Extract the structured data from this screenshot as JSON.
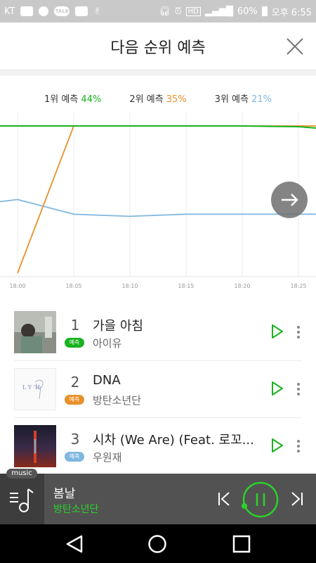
{
  "status_bar": {
    "carrier": "KT",
    "battery": "60%",
    "time": "오후 6:55",
    "talk": "TALK",
    "hd": "HD"
  },
  "header": {
    "title": "다음 순위 예측"
  },
  "legend": [
    {
      "label": "1위 예측",
      "value": "44%",
      "color": "#19b31f"
    },
    {
      "label": "2위 예측",
      "value": "35%",
      "color": "#e8902b"
    },
    {
      "label": "3위 예측",
      "value": "21%",
      "color": "#7fb7e0"
    }
  ],
  "chart_data": {
    "type": "line",
    "x": [
      "18:00",
      "18:05",
      "18:10",
      "18:15",
      "18:20",
      "18:25"
    ],
    "series": [
      {
        "values": [
          1,
          1,
          1,
          1,
          1,
          1.01
        ],
        "color": "#19b31f"
      },
      {
        "values": [
          3.1,
          1,
          1,
          1,
          1,
          1
        ],
        "color": "#e8902b"
      },
      {
        "values": [
          2.05,
          2.26,
          2.29,
          2.26,
          2.26,
          2.26
        ],
        "color": "#7fb7e0"
      }
    ],
    "ylim": [
      0.98,
      3.15
    ],
    "grid": true
  },
  "songs": [
    {
      "rank": "1",
      "title": "가을 아침",
      "artist": "아이유",
      "badge": "예측",
      "badge_color": "#19b31f"
    },
    {
      "rank": "2",
      "title": "DNA",
      "artist": "방탄소년단",
      "badge": "예측",
      "badge_color": "#e8902b"
    },
    {
      "rank": "3",
      "title": "시차 (We Are) (Feat. 로꼬...",
      "artist": "우원재",
      "badge": "예측",
      "badge_color": "#7fb7e0"
    }
  ],
  "player": {
    "tag": "music",
    "title": "봄날",
    "artist": "방탄소년단"
  },
  "colors": {
    "accent": "#19b31f",
    "player_green": "#2ad22a"
  }
}
